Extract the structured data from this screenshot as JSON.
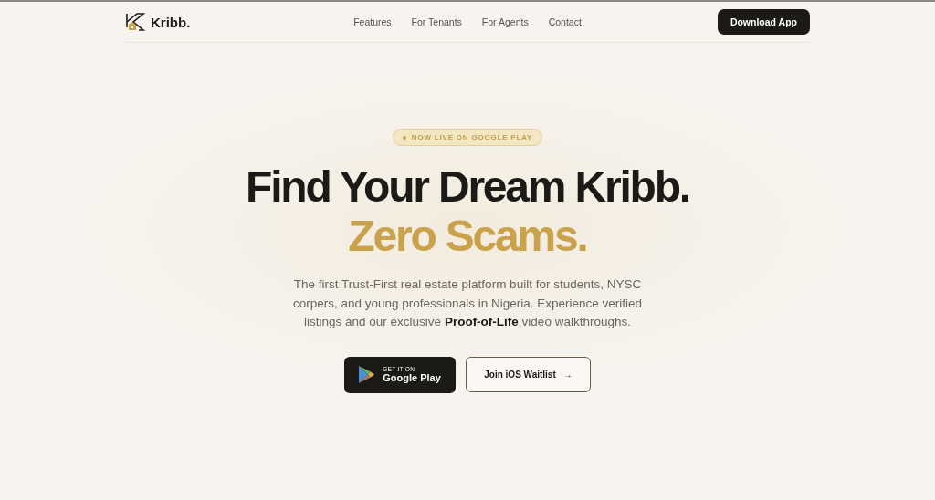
{
  "brand": {
    "name": "Kribb."
  },
  "nav": {
    "links": [
      {
        "label": "Features"
      },
      {
        "label": "For Tenants"
      },
      {
        "label": "For Agents"
      },
      {
        "label": "Contact"
      }
    ],
    "cta": "Download App"
  },
  "hero": {
    "badge": "NOW LIVE ON GOOGLE PLAY",
    "title_line_1": "Find Your Dream Kribb.",
    "title_line_2": "Zero Scams.",
    "description": "The first Trust-First real estate platform built for students, NYSC corpers, and young professionals in Nigeria. Experience verified listings and our exclusive **Proof-of-Life** video walkthroughs.",
    "store_button": {
      "small": "GET IT ON",
      "large": "Google Play"
    },
    "waitlist_button": {
      "label": "Join iOS Waitlist",
      "arrow": "→"
    }
  }
}
